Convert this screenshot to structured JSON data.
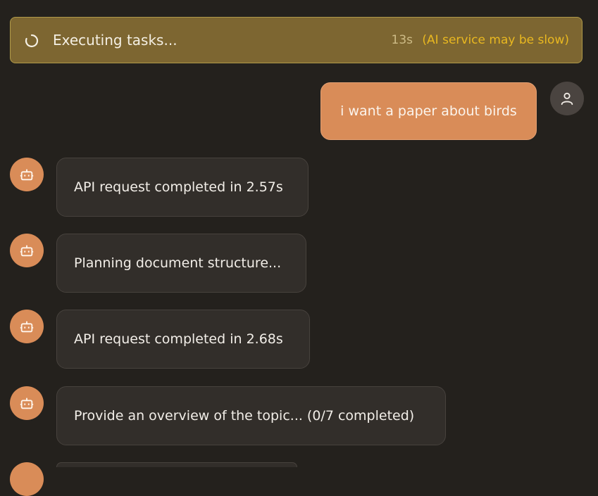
{
  "status": {
    "text": "Executing tasks...",
    "elapsed": "13s",
    "note": "(AI service may be slow)"
  },
  "colors": {
    "accent": "#d98c58",
    "status_bg": "#7d6631",
    "warning": "#e9b820",
    "background": "#24211d"
  },
  "icons": {
    "status": "loading-spinner-icon",
    "user": "user-icon",
    "bot": "bot-icon"
  },
  "messages": {
    "user": "i want a paper about birds",
    "bot": [
      "API request completed in 2.57s",
      "Planning document structure...",
      "API request completed in 2.68s",
      "Provide an overview of the topic... (0/7 completed)"
    ]
  }
}
